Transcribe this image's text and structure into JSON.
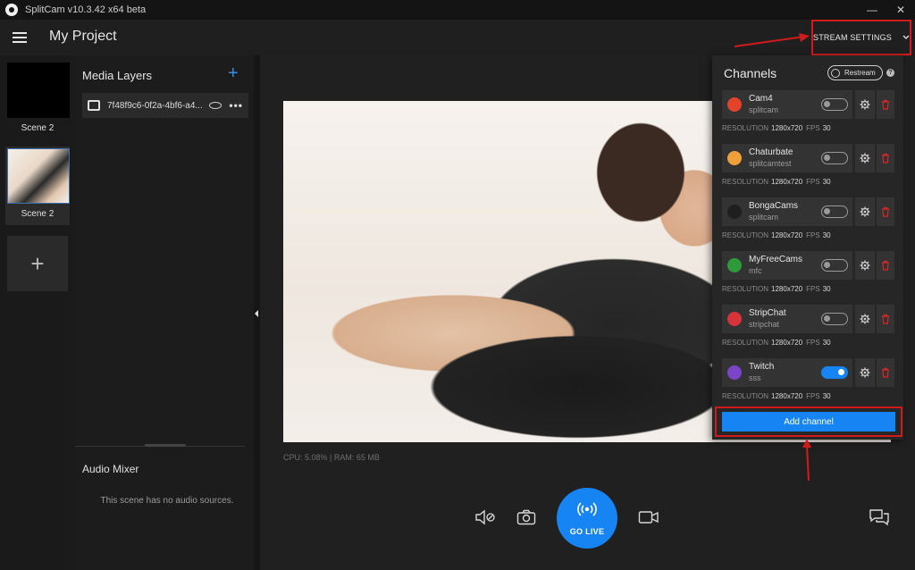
{
  "titlebar": {
    "title": "SplitCam v10.3.42 x64 beta",
    "minimize": "—",
    "close": "✕"
  },
  "header": {
    "project_title": "My Project",
    "stream_settings": "STREAM SETTINGS"
  },
  "scenes": [
    {
      "label": "Scene 2"
    },
    {
      "label": "Scene 2"
    }
  ],
  "add_scene": "+",
  "media_layers": {
    "title": "Media Layers",
    "add": "+",
    "items": [
      {
        "name": "7f48f9c6-0f2a-4bf6-a4..."
      }
    ],
    "dots": "•••"
  },
  "audio_mixer": {
    "title": "Audio Mixer",
    "empty": "This scene has no audio sources."
  },
  "stats": "CPU: 5.08% | RAM: 65 MB",
  "controls": {
    "go_live": "GO LIVE"
  },
  "channels": {
    "title": "Channels",
    "restream": "Restream",
    "help": "?",
    "res_label": "RESOLUTION",
    "fps_label": "FPS",
    "items": [
      {
        "name": "Cam4",
        "user": "splitcam",
        "resolution": "1280x720",
        "fps": "30",
        "enabled": false,
        "color": "#e3432b"
      },
      {
        "name": "Chaturbate",
        "user": "splitcamtest",
        "resolution": "1280x720",
        "fps": "30",
        "enabled": false,
        "color": "#f0a03a"
      },
      {
        "name": "BongaCams",
        "user": "splitcam",
        "resolution": "1280x720",
        "fps": "30",
        "enabled": false,
        "color": "#1f1f1f"
      },
      {
        "name": "MyFreeCams",
        "user": "mfc",
        "resolution": "1280x720",
        "fps": "30",
        "enabled": false,
        "color": "#2e9b3a"
      },
      {
        "name": "StripChat",
        "user": "stripchat",
        "resolution": "1280x720",
        "fps": "30",
        "enabled": false,
        "color": "#d6333a"
      },
      {
        "name": "Twitch",
        "user": "sss",
        "resolution": "1280x720",
        "fps": "30",
        "enabled": true,
        "color": "#7b45c9"
      }
    ],
    "add_channel": "Add channel"
  },
  "colors": {
    "accent": "#1684f2",
    "highlight": "#d11b1b",
    "delete": "#d62828"
  }
}
